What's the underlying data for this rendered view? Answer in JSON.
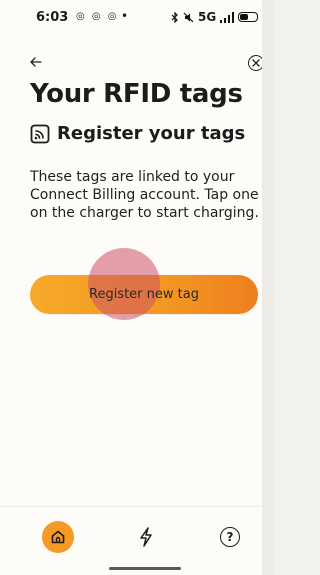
{
  "status_bar": {
    "time": "6:03",
    "notification_icons": "◎ ◎ ◎",
    "dot": "•",
    "network": "5G"
  },
  "page": {
    "title": "Your RFID tags",
    "section_title": "Register your tags",
    "description": "These tags are linked to your Connect Billing account. Tap one on the charger to start charging.",
    "register_button_label": "Register new tag"
  },
  "bottom_nav": {
    "items": [
      {
        "icon": "home-icon",
        "active": true
      },
      {
        "icon": "lightning-icon",
        "active": false
      },
      {
        "icon": "help-icon",
        "active": false
      }
    ]
  },
  "colors": {
    "accent": "#f59a25",
    "accent_dark": "#ee7f1f",
    "text": "#1c1c1c",
    "background": "#fdfcf9",
    "tap_indicator": "#cd5064"
  }
}
